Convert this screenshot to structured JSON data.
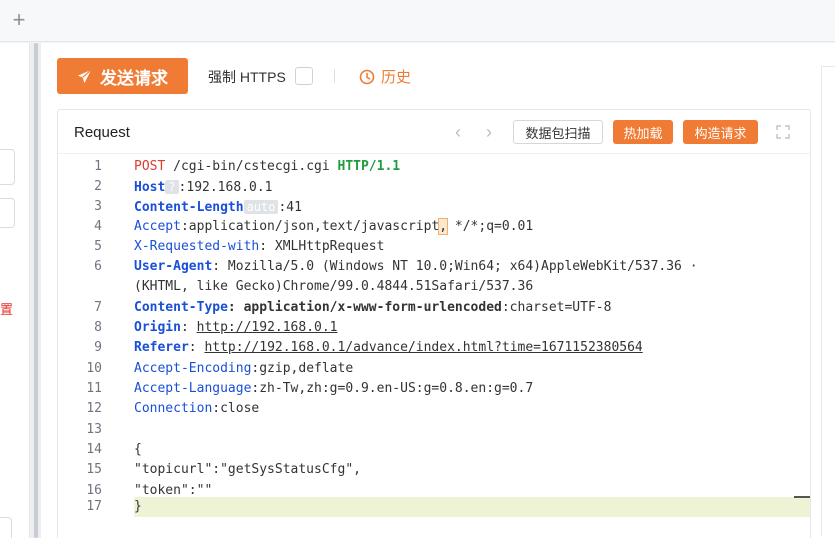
{
  "toolbar": {
    "send_label": "发送请求",
    "force_https_label": "强制 HTTPS",
    "force_https_checked": false,
    "history_label": "历史"
  },
  "left_panel": {
    "partial_text": "置"
  },
  "request": {
    "title": "Request",
    "scan_label": "数据包扫描",
    "hot_reload_label": "热加载",
    "build_label": "构造请求",
    "lines": [
      {
        "n": "1",
        "method": "POST",
        "path": " /cgi-bin/cstecgi.cgi ",
        "proto": "HTTP/1.1"
      },
      {
        "n": "2",
        "name": "Host",
        "badge": "?",
        "value": ":192.168.0.1"
      },
      {
        "n": "3",
        "name": "Content-Length",
        "badge": "auto",
        "value": ":41"
      },
      {
        "n": "4",
        "name": "Accept",
        "value_a": ":application/json,text/javascript",
        "value_hl": ",",
        "value_b": " */*;q=0.01"
      },
      {
        "n": "5",
        "name": "X-Requested-with",
        "value": ": XMLHttpRequest"
      },
      {
        "n": "6",
        "name": "User-Agent",
        "value": ": Mozilla/5.0 (Windows NT 10.0;Win64; x64)AppleWebKit/537.36 ·"
      },
      {
        "n": "",
        "value": "(KHTML, like Gecko)Chrome/99.0.4844.51Safari/537.36"
      },
      {
        "n": "7",
        "name": "Content-Type",
        "value": ": application/x-www-form-urlencoded",
        "value_b": ":charset=UTF-8"
      },
      {
        "n": "8",
        "name": "Origin",
        "value": ": ",
        "url": "http://192.168.0.1"
      },
      {
        "n": "9",
        "name": "Referer",
        "value": ": ",
        "url": "http://192.168.0.1/advance/index.html?time=1671152380564"
      },
      {
        "n": "10",
        "name": "Accept-Encoding",
        "value": ":gzip,deflate"
      },
      {
        "n": "11",
        "name": "Accept-Language",
        "value": ":zh-Tw,zh:g=0.9.en-US:g=0.8.en:g=0.7"
      },
      {
        "n": "12",
        "name": "Connection",
        "value": ":close"
      },
      {
        "n": "13",
        "value": ""
      },
      {
        "n": "14",
        "value": "{"
      },
      {
        "n": "15",
        "value": "\"topicurl\":\"getSysStatusCfg\","
      },
      {
        "n": "16",
        "value": "\"token\":\"\""
      },
      {
        "n": "17",
        "value": "}"
      }
    ]
  },
  "colors": {
    "accent": "#f07b34",
    "header_name": "#1a4fd8",
    "method": "#d93c30",
    "protocol": "#1f9c3b"
  }
}
